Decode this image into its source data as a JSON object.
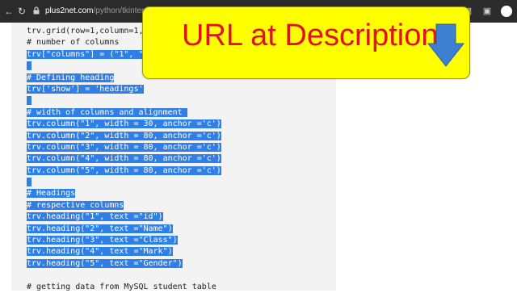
{
  "browser": {
    "url_host": "plus2net.com",
    "url_path": "/python/tkinter-mysql-treev"
  },
  "banner": {
    "text": "URL at Description"
  },
  "code": {
    "lines": [
      {
        "text": "trv.grid(row=1,column=1,padx",
        "selected": false
      },
      {
        "text": "# number of columns",
        "selected": false
      },
      {
        "text": "trv[\"columns\"] = (\"1\", \"2\",",
        "selected": true
      },
      {
        "text": " ",
        "selected": true
      },
      {
        "text": "# Defining heading",
        "selected": true
      },
      {
        "text": "trv['show'] = 'headings'",
        "selected": true
      },
      {
        "text": " ",
        "selected": true
      },
      {
        "text": "# width of columns and alignment ",
        "selected": true
      },
      {
        "text": "trv.column(\"1\", width = 30, anchor ='c')",
        "selected": true
      },
      {
        "text": "trv.column(\"2\", width = 80, anchor ='c')",
        "selected": true
      },
      {
        "text": "trv.column(\"3\", width = 80, anchor ='c')",
        "selected": true
      },
      {
        "text": "trv.column(\"4\", width = 80, anchor ='c')",
        "selected": true
      },
      {
        "text": "trv.column(\"5\", width = 80, anchor ='c')",
        "selected": true
      },
      {
        "text": " ",
        "selected": true
      },
      {
        "text": "# Headings",
        "selected": true
      },
      {
        "text": "# respective columns",
        "selected": true
      },
      {
        "text": "trv.heading(\"1\", text =\"id\")",
        "selected": true
      },
      {
        "text": "trv.heading(\"2\", text =\"Name\")",
        "selected": true
      },
      {
        "text": "trv.heading(\"3\", text =\"Class\")",
        "selected": true
      },
      {
        "text": "trv.heading(\"4\", text =\"Mark\")",
        "selected": true
      },
      {
        "text": "trv.heading(\"5\", text =\"Gender\")",
        "selected": true
      },
      {
        "text": " ",
        "selected": false
      },
      {
        "text": "# getting data from MySQL student table",
        "selected": false
      }
    ]
  },
  "icons": {
    "back": "back-arrow-icon",
    "forward": "forward-arrow-icon",
    "reload": "reload-icon",
    "lock": "lock-icon",
    "share": "share-icon",
    "bookmark": "star-icon",
    "extensions": "puzzle-icon",
    "cast": "cast-icon",
    "profile": "avatar-icon",
    "banner_arrow": "down-arrow-icon"
  },
  "colors": {
    "banner_bg": "#ffff00",
    "banner_text": "#e0121b",
    "selection": "#2f7fe8",
    "arrow": "#3d7fd0"
  }
}
